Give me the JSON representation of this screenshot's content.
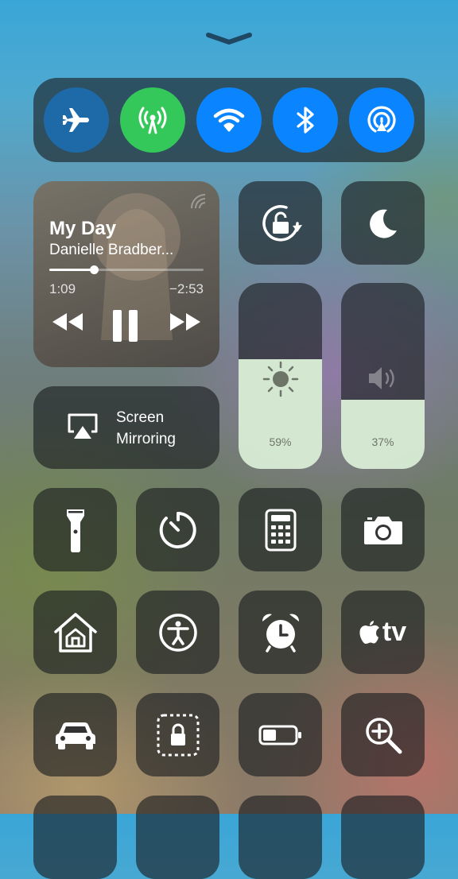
{
  "now_playing": {
    "title": "My Day",
    "artist": "Danielle Bradber...",
    "elapsed": "1:09",
    "remaining": "−2:53",
    "progress": 0.29
  },
  "screen_mirroring": {
    "line1": "Screen",
    "line2": "Mirroring"
  },
  "brightness": {
    "value": 0.59,
    "label": "59%"
  },
  "volume": {
    "value": 0.37,
    "label": "37%"
  },
  "connectivity": {
    "airplane": {
      "icon": "airplane-icon",
      "state": "off"
    },
    "cellular": {
      "icon": "antenna-icon",
      "state": "on",
      "color": "#34c759"
    },
    "wifi": {
      "icon": "wifi-icon",
      "state": "on",
      "color": "#0a84ff"
    },
    "bluetooth": {
      "icon": "bluetooth-icon",
      "state": "on",
      "color": "#0a84ff"
    },
    "airdrop": {
      "icon": "airdrop-icon",
      "state": "on",
      "color": "#0a84ff"
    }
  },
  "tv_label": "tv",
  "icons": [
    "flashlight-icon",
    "timer-icon",
    "calculator-icon",
    "camera-icon",
    "home-icon",
    "accessibility-icon",
    "alarm-icon",
    "apple-tv-icon",
    "car-icon",
    "guided-access-icon",
    "battery-icon",
    "magnifier-icon"
  ]
}
